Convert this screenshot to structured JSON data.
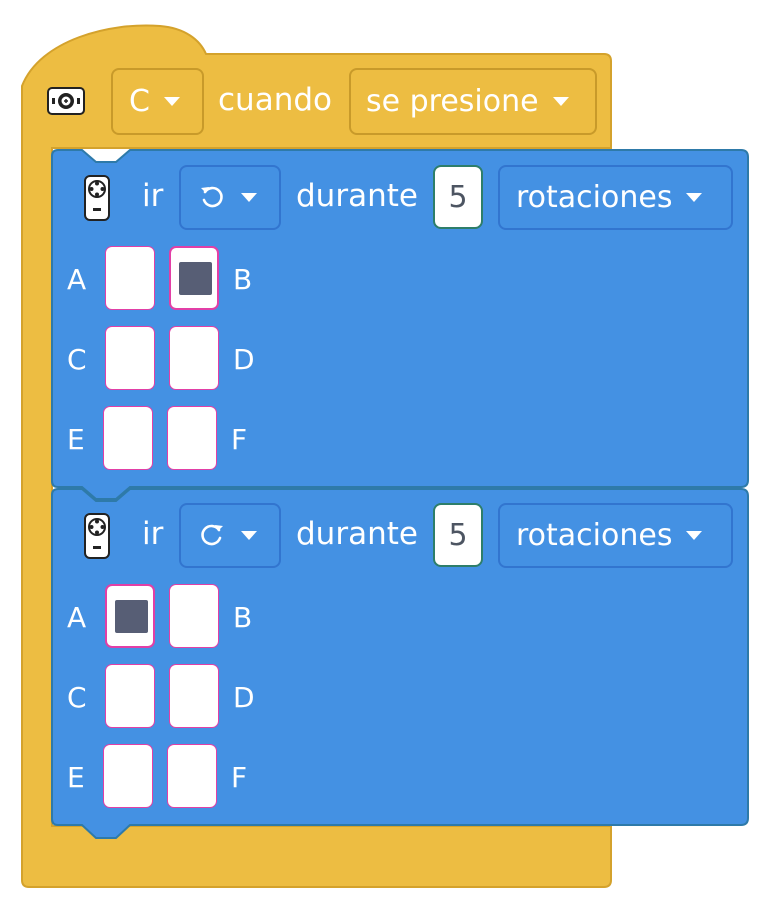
{
  "hat": {
    "icon": "controller-button-icon",
    "button_value": "C",
    "when_label": "cuando",
    "event_value": "se presione"
  },
  "blocks": [
    {
      "icon": "remote-control-icon",
      "go_label": "ir",
      "direction_icon": "rotate-counterclockwise-icon",
      "during_label": "durante",
      "amount": "5",
      "unit": "rotaciones",
      "ports": [
        {
          "label": "A",
          "selected": false
        },
        {
          "label": "B",
          "selected": true
        },
        {
          "label": "C",
          "selected": false
        },
        {
          "label": "D",
          "selected": false
        },
        {
          "label": "E",
          "selected": false
        },
        {
          "label": "F",
          "selected": false
        }
      ]
    },
    {
      "icon": "remote-control-icon",
      "go_label": "ir",
      "direction_icon": "rotate-clockwise-icon",
      "during_label": "durante",
      "amount": "5",
      "unit": "rotaciones",
      "ports": [
        {
          "label": "A",
          "selected": true
        },
        {
          "label": "B",
          "selected": false
        },
        {
          "label": "C",
          "selected": false
        },
        {
          "label": "D",
          "selected": false
        },
        {
          "label": "E",
          "selected": false
        },
        {
          "label": "F",
          "selected": false
        }
      ]
    }
  ],
  "colors": {
    "event_block": "#EDBD42",
    "event_border": "#D4A22C",
    "motor_block": "#4491E3",
    "motor_border": "#2E7AA9",
    "port_border": "#E23FA6",
    "selected_fill": "#575E75"
  }
}
